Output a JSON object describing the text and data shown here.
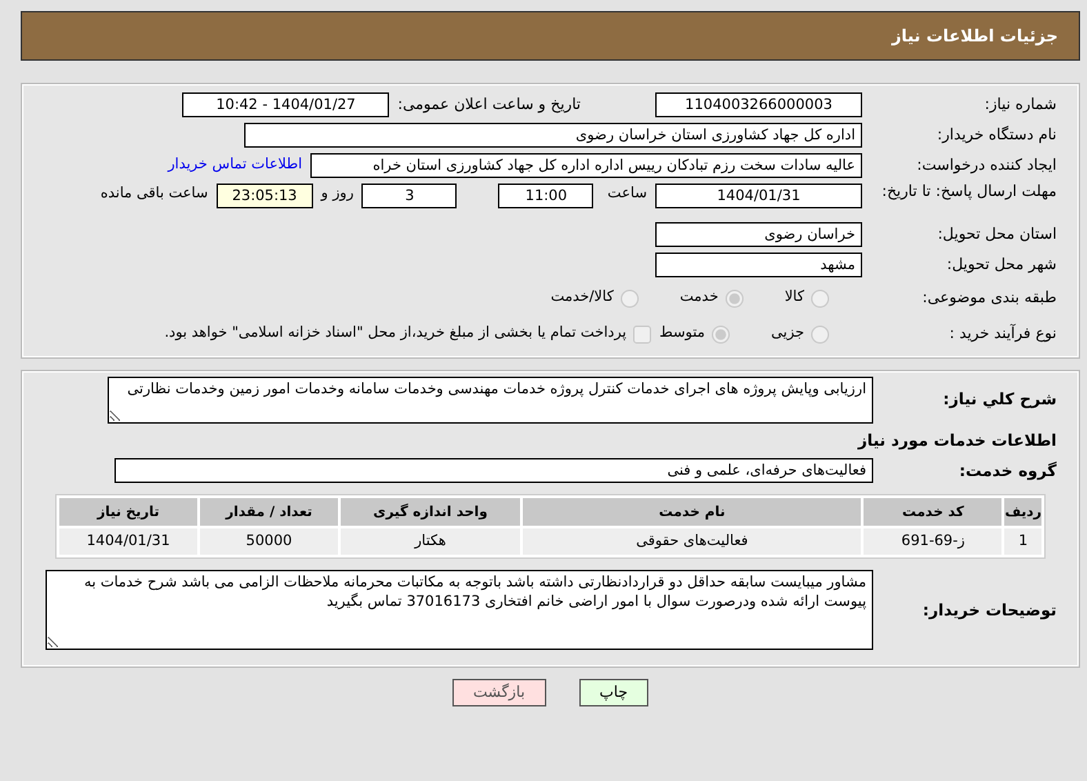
{
  "header": {
    "title": "جزئیات اطلاعات نیاز"
  },
  "need_number": {
    "label": "شماره نیاز:",
    "value": "1104003266000003"
  },
  "announce": {
    "label": "تاریخ و ساعت اعلان عمومی:",
    "value": "1404/01/27 - 10:42"
  },
  "buyer_org": {
    "label": "نام دستگاه خریدار:",
    "value": "اداره کل جهاد کشاورزی استان خراسان رضوی"
  },
  "requester": {
    "label": "ایجاد کننده درخواست:",
    "value": "عالیه سادات سخت رزم تبادکان رییس اداره  اداره کل جهاد کشاورزی استان خراه",
    "link": "اطلاعات تماس خریدار"
  },
  "deadline": {
    "label": "مهلت ارسال پاسخ: تا تاریخ:",
    "date": "1404/01/31",
    "time_label": "ساعت",
    "time": "11:00",
    "days": "3",
    "days_label": "روز و",
    "remaining": "23:05:13",
    "remaining_label": "ساعت باقی مانده"
  },
  "province": {
    "label": "استان محل تحویل:",
    "value": "خراسان رضوی"
  },
  "city": {
    "label": "شهر محل تحویل:",
    "value": "مشهد"
  },
  "category": {
    "label": "طبقه بندی موضوعی:",
    "options": [
      {
        "label": "کالا",
        "selected": false
      },
      {
        "label": "خدمت",
        "selected": true
      },
      {
        "label": "کالا/خدمت",
        "selected": false
      }
    ]
  },
  "process": {
    "label": "نوع فرآیند خرید :",
    "options": [
      {
        "label": "جزیی",
        "selected": false
      },
      {
        "label": "متوسط",
        "selected": true
      }
    ],
    "treasury": {
      "label": "پرداخت تمام یا بخشی از مبلغ خرید،از محل \"اسناد خزانه اسلامی\" خواهد بود.",
      "checked": false
    }
  },
  "description": {
    "label": "شرح کلي نياز:",
    "value": "ارزیابی وپایش پروژه های اجرای خدمات کنترل پروژه خدمات مهندسی وخدمات سامانه وخدمات امور زمین وخدمات نظارتی"
  },
  "services_title": "اطلاعات خدمات مورد نیاز",
  "service_group": {
    "label": "گروه خدمت:",
    "value": "فعالیت‌های حرفه‌ای، علمی و فنی"
  },
  "table": {
    "columns": [
      "ردیف",
      "کد خدمت",
      "نام خدمت",
      "واحد اندازه گیری",
      "تعداد / مقدار",
      "تاریخ نیاز"
    ],
    "rows": [
      [
        "1",
        "ز-69-691",
        "فعالیت‌های حقوقی",
        "هکتار",
        "50000",
        "1404/01/31"
      ]
    ]
  },
  "buyer_notes": {
    "label": "توضیحات خریدار:",
    "value": "مشاور میبایست سابقه حداقل دو قراردادنظارتی داشته باشد باتوجه به مکاتبات محرمانه ملاحظات الزامی می باشد شرح خدمات به پیوست ارائه شده ودرصورت سوال با امور اراضی خانم افتخاری 37016173 تماس بگیرید"
  },
  "buttons": [
    {
      "kind": "print",
      "label": "چاپ"
    },
    {
      "kind": "back",
      "label": "بازگشت"
    }
  ]
}
